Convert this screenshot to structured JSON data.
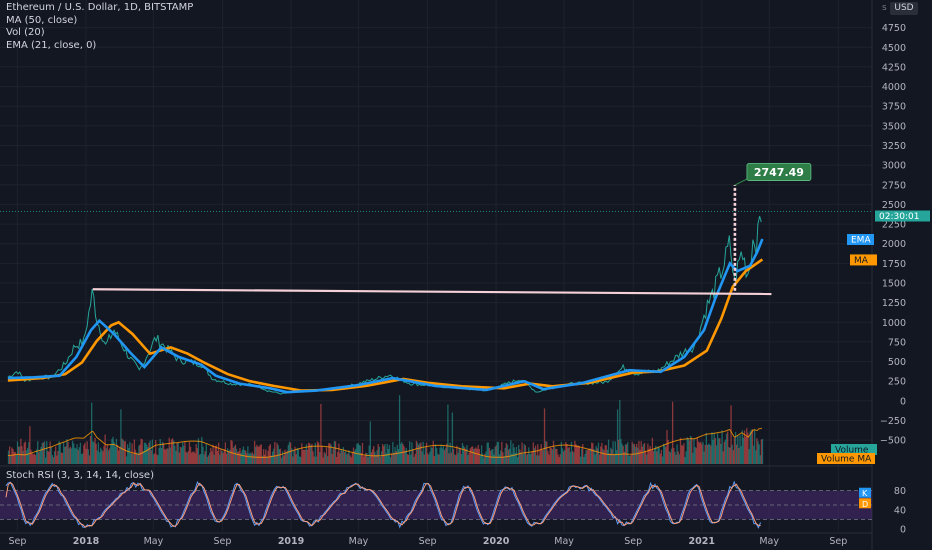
{
  "legend": {
    "title": "Ethereum / U.S. Dollar, 1D, BITSTAMP",
    "ma": "MA (50, close)",
    "vol": "Vol (20)",
    "ema": "EMA (21, close, 0)"
  },
  "currency": "USD",
  "currency_prefix": "s",
  "stoch_label": "Stoch RSI (3, 3, 14, 14, close)",
  "colors": {
    "background": "#131722",
    "grid": "#1e222d",
    "text": "#b2b5be",
    "ema": "#2196f3",
    "ma": "#ff9800",
    "resistance": "#f5d0d6",
    "price_up": "#26a69a",
    "price_down": "#ef5350",
    "callout": "#2e7d46",
    "stoch_band": "#4a2a73",
    "stoch_k": "#5b9cf6",
    "stoch_d": "#ff9e7a"
  },
  "chart_data": {
    "type": "line",
    "price_axis": {
      "ticks": [
        4750,
        4500,
        4250,
        4000,
        3750,
        3500,
        3250,
        3000,
        2750,
        2500,
        2250,
        2000,
        1750,
        1500,
        1250,
        1000,
        750,
        500,
        250,
        0,
        -250,
        -500
      ],
      "ylim": [
        -600,
        5000
      ]
    },
    "time_axis": [
      "Sep",
      "2018",
      "May",
      "Sep",
      "2019",
      "May",
      "Sep",
      "2020",
      "May",
      "Sep",
      "2021",
      "May",
      "Sep"
    ],
    "bold_ticks": [
      "2018",
      "2019",
      "2020",
      "2021"
    ],
    "stoch_axis": {
      "ticks": [
        80,
        40,
        0
      ],
      "band": [
        20,
        80
      ]
    },
    "price_series": [
      {
        "date": "2017-08-15",
        "price": 300
      },
      {
        "date": "2017-09-01",
        "price": 380
      },
      {
        "date": "2017-09-15",
        "price": 250
      },
      {
        "date": "2017-10-01",
        "price": 300
      },
      {
        "date": "2017-11-01",
        "price": 300
      },
      {
        "date": "2017-11-25",
        "price": 470
      },
      {
        "date": "2017-12-12",
        "price": 700
      },
      {
        "date": "2017-12-28",
        "price": 750
      },
      {
        "date": "2018-01-13",
        "price": 1400
      },
      {
        "date": "2018-01-20",
        "price": 1050
      },
      {
        "date": "2018-02-05",
        "price": 700
      },
      {
        "date": "2018-02-20",
        "price": 900
      },
      {
        "date": "2018-03-15",
        "price": 600
      },
      {
        "date": "2018-04-06",
        "price": 380
      },
      {
        "date": "2018-05-05",
        "price": 800
      },
      {
        "date": "2018-05-20",
        "price": 700
      },
      {
        "date": "2018-06-15",
        "price": 520
      },
      {
        "date": "2018-07-25",
        "price": 470
      },
      {
        "date": "2018-08-15",
        "price": 280
      },
      {
        "date": "2018-09-15",
        "price": 220
      },
      {
        "date": "2018-11-01",
        "price": 200
      },
      {
        "date": "2018-11-20",
        "price": 130
      },
      {
        "date": "2018-12-15",
        "price": 90
      },
      {
        "date": "2019-01-15",
        "price": 125
      },
      {
        "date": "2019-03-01",
        "price": 135
      },
      {
        "date": "2019-04-10",
        "price": 180
      },
      {
        "date": "2019-06-26",
        "price": 330
      },
      {
        "date": "2019-08-01",
        "price": 220
      },
      {
        "date": "2019-10-01",
        "price": 180
      },
      {
        "date": "2019-12-15",
        "price": 130
      },
      {
        "date": "2020-02-14",
        "price": 280
      },
      {
        "date": "2020-03-13",
        "price": 110
      },
      {
        "date": "2020-05-01",
        "price": 210
      },
      {
        "date": "2020-07-15",
        "price": 240
      },
      {
        "date": "2020-08-15",
        "price": 430
      },
      {
        "date": "2020-09-05",
        "price": 350
      },
      {
        "date": "2020-10-15",
        "price": 380
      },
      {
        "date": "2020-11-25",
        "price": 600
      },
      {
        "date": "2020-12-20",
        "price": 700
      },
      {
        "date": "2021-01-10",
        "price": 1200
      },
      {
        "date": "2021-01-20",
        "price": 1350
      },
      {
        "date": "2021-02-10",
        "price": 1750
      },
      {
        "date": "2021-02-20",
        "price": 2000
      },
      {
        "date": "2021-02-28",
        "price": 1500
      },
      {
        "date": "2021-03-13",
        "price": 1900
      },
      {
        "date": "2021-03-25",
        "price": 1600
      },
      {
        "date": "2021-04-03",
        "price": 2100
      },
      {
        "date": "2021-04-10",
        "price": 2000
      },
      {
        "date": "2021-04-16",
        "price": 2450
      },
      {
        "date": "2021-04-19",
        "price": 2250
      }
    ],
    "ema_series": [
      {
        "date": "2017-08-15",
        "price": 290
      },
      {
        "date": "2017-10-01",
        "price": 300
      },
      {
        "date": "2017-11-15",
        "price": 320
      },
      {
        "date": "2017-12-15",
        "price": 560
      },
      {
        "date": "2018-01-10",
        "price": 900
      },
      {
        "date": "2018-01-25",
        "price": 1020
      },
      {
        "date": "2018-02-20",
        "price": 850
      },
      {
        "date": "2018-03-20",
        "price": 620
      },
      {
        "date": "2018-04-15",
        "price": 430
      },
      {
        "date": "2018-05-15",
        "price": 680
      },
      {
        "date": "2018-06-15",
        "price": 560
      },
      {
        "date": "2018-07-25",
        "price": 460
      },
      {
        "date": "2018-08-20",
        "price": 320
      },
      {
        "date": "2018-10-01",
        "price": 220
      },
      {
        "date": "2018-11-25",
        "price": 160
      },
      {
        "date": "2018-12-25",
        "price": 110
      },
      {
        "date": "2019-02-15",
        "price": 130
      },
      {
        "date": "2019-05-01",
        "price": 200
      },
      {
        "date": "2019-07-01",
        "price": 290
      },
      {
        "date": "2019-09-15",
        "price": 190
      },
      {
        "date": "2019-12-15",
        "price": 140
      },
      {
        "date": "2020-02-20",
        "price": 250
      },
      {
        "date": "2020-03-25",
        "price": 150
      },
      {
        "date": "2020-06-01",
        "price": 225
      },
      {
        "date": "2020-08-25",
        "price": 390
      },
      {
        "date": "2020-10-20",
        "price": 370
      },
      {
        "date": "2020-12-01",
        "price": 560
      },
      {
        "date": "2021-01-05",
        "price": 900
      },
      {
        "date": "2021-01-25",
        "price": 1300
      },
      {
        "date": "2021-02-20",
        "price": 1750
      },
      {
        "date": "2021-03-05",
        "price": 1650
      },
      {
        "date": "2021-03-28",
        "price": 1720
      },
      {
        "date": "2021-04-10",
        "price": 1900
      },
      {
        "date": "2021-04-19",
        "price": 2060
      }
    ],
    "ma_series": [
      {
        "date": "2017-08-15",
        "price": 260
      },
      {
        "date": "2017-10-15",
        "price": 290
      },
      {
        "date": "2017-11-25",
        "price": 340
      },
      {
        "date": "2017-12-25",
        "price": 490
      },
      {
        "date": "2018-01-20",
        "price": 760
      },
      {
        "date": "2018-02-15",
        "price": 960
      },
      {
        "date": "2018-02-28",
        "price": 1000
      },
      {
        "date": "2018-03-25",
        "price": 850
      },
      {
        "date": "2018-04-25",
        "price": 600
      },
      {
        "date": "2018-06-01",
        "price": 680
      },
      {
        "date": "2018-07-01",
        "price": 600
      },
      {
        "date": "2018-08-01",
        "price": 480
      },
      {
        "date": "2018-09-10",
        "price": 340
      },
      {
        "date": "2018-10-20",
        "price": 250
      },
      {
        "date": "2018-12-01",
        "price": 190
      },
      {
        "date": "2019-01-20",
        "price": 130
      },
      {
        "date": "2019-03-15",
        "price": 140
      },
      {
        "date": "2019-05-15",
        "price": 190
      },
      {
        "date": "2019-07-20",
        "price": 280
      },
      {
        "date": "2019-09-01",
        "price": 230
      },
      {
        "date": "2019-11-01",
        "price": 185
      },
      {
        "date": "2020-01-15",
        "price": 160
      },
      {
        "date": "2020-03-01",
        "price": 220
      },
      {
        "date": "2020-04-10",
        "price": 185
      },
      {
        "date": "2020-06-15",
        "price": 230
      },
      {
        "date": "2020-09-01",
        "price": 360
      },
      {
        "date": "2020-10-15",
        "price": 375
      },
      {
        "date": "2020-12-01",
        "price": 450
      },
      {
        "date": "2021-01-10",
        "price": 640
      },
      {
        "date": "2021-02-05",
        "price": 1050
      },
      {
        "date": "2021-02-25",
        "price": 1450
      },
      {
        "date": "2021-03-20",
        "price": 1650
      },
      {
        "date": "2021-04-19",
        "price": 1800
      }
    ],
    "resistance_line": {
      "from": {
        "date": "2018-01-13",
        "price": 1420
      },
      "to": {
        "date": "2021-05-05",
        "price": 1360
      }
    },
    "target_line": {
      "date": "2021-03-01",
      "from_price": 1400,
      "to_price": 2747.49
    },
    "target_label": "2747.49",
    "current_time_label": "02:30:01",
    "current_price": 2410,
    "volume_label": "Volume",
    "volume_ma_label": "Volume MA",
    "ema_tag": "EMA",
    "ma_tag": "MA",
    "stoch_k_tag": "K",
    "stoch_d_tag": "D",
    "date_range": [
      "2017-08-01",
      "2021-10-31"
    ]
  }
}
